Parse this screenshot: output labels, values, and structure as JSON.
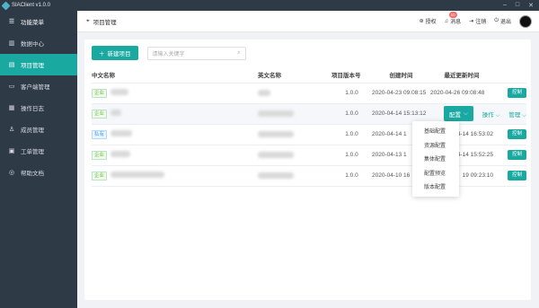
{
  "window": {
    "title": "SIAClient v1.0.0"
  },
  "sidebar": {
    "items": [
      {
        "label": "功能菜单",
        "icon": "menu-icon"
      },
      {
        "label": "数据中心",
        "icon": "chart-icon"
      },
      {
        "label": "项目管理",
        "icon": "project-icon",
        "active": true
      },
      {
        "label": "客户端管理",
        "icon": "client-icon"
      },
      {
        "label": "操作日志",
        "icon": "log-icon"
      },
      {
        "label": "成员管理",
        "icon": "members-icon"
      },
      {
        "label": "工单管理",
        "icon": "ticket-icon"
      },
      {
        "label": "帮助文档",
        "icon": "help-icon"
      }
    ]
  },
  "topbar": {
    "breadcrumb": "项目管理",
    "license": "授权",
    "messages": "消息",
    "message_count": "10",
    "logout_account": "注销",
    "exit": "退出"
  },
  "toolbar": {
    "new_label": "新建项目",
    "search_placeholder": "请输入关键字"
  },
  "table": {
    "headers": [
      "中文名称",
      "英文名称",
      "项目版本号",
      "创建时间",
      "最近更新时间"
    ],
    "rows": [
      {
        "tag": "企业",
        "version": "1.0.0",
        "created": "2020-04-23 09:08:15",
        "updated": "2020-04-26 09:08:48",
        "action": "控制"
      },
      {
        "tag": "企业",
        "version": "1.0.0",
        "created": "2020-04-14 15:13:12",
        "updated": "",
        "action": ""
      },
      {
        "tag": "私有",
        "version": "1.0.0",
        "created": "2020-04-14 1",
        "updated": "2020-04-14 16:53:02",
        "action": "控制"
      },
      {
        "tag": "企业",
        "version": "1.0.0",
        "created": "2020-04-13 1",
        "updated": "2020-04-14 15:52:25",
        "action": "控制"
      },
      {
        "tag": "企业",
        "version": "1.0.0",
        "created": "2020-04-10 16",
        "updated": "19 09:23:10",
        "action": "控制"
      }
    ],
    "row2_actions": {
      "config": "配置",
      "operate": "操作",
      "manage": "管理"
    }
  },
  "dropdown": {
    "items": [
      "基础配置",
      "资源配置",
      "集体配置",
      "配置预览",
      "版本配置"
    ]
  },
  "colors": {
    "accent": "#19a9a1",
    "sidebar": "#2f3a47"
  }
}
